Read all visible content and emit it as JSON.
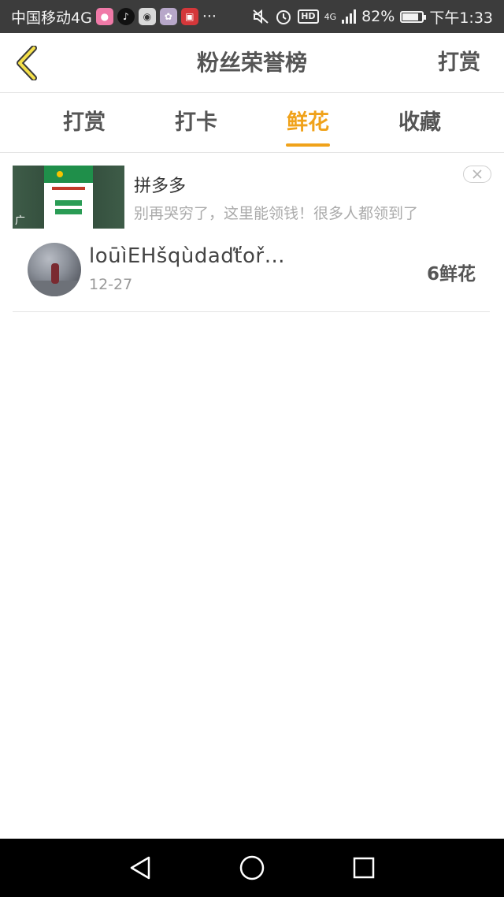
{
  "status_bar": {
    "carrier": "中国移动4G",
    "more": "···",
    "signal": "4G",
    "hd": "HD",
    "battery_percent": "82%",
    "time": "下午1:33",
    "battery_level": 0.82,
    "icons": [
      "pink-app-icon",
      "tiktok-icon",
      "chat-app-icon",
      "cartoon-app-icon",
      "red-app-icon",
      "mute-icon",
      "alarm-icon"
    ]
  },
  "header": {
    "title": "粉丝荣誉榜",
    "action_label": "打赏",
    "back_icon": "chevron-left-icon"
  },
  "tabs": [
    {
      "label": "打赏",
      "active": false
    },
    {
      "label": "打卡",
      "active": false
    },
    {
      "label": "鲜花",
      "active": true
    },
    {
      "label": "收藏",
      "active": false
    }
  ],
  "ad": {
    "title": "拼多多",
    "description": "别再哭穷了，这里能领钱！很多人都领到了",
    "ad_mark": "广",
    "close_icon": "close-icon"
  },
  "list": [
    {
      "name": "loūìEHšqùdaďťoř…",
      "date": "12-27",
      "count": "6鲜花"
    }
  ],
  "colors": {
    "accent": "#f0a21a",
    "status_bar": "#3c3c3c",
    "nav_bar": "#000000"
  },
  "nav": {
    "icons": [
      "back-triangle-icon",
      "home-circle-icon",
      "recents-square-icon"
    ]
  }
}
